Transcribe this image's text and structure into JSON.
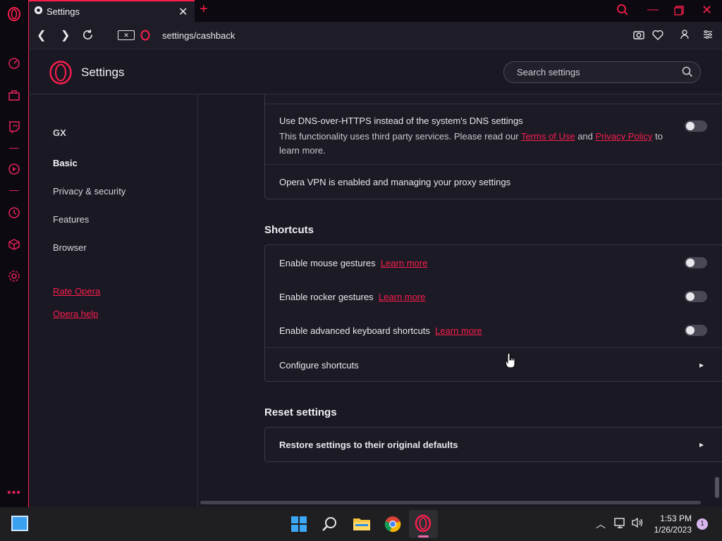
{
  "tab": {
    "title": "Settings"
  },
  "address": {
    "url": "settings/cashback"
  },
  "header": {
    "title": "Settings",
    "search_placeholder": "Search settings"
  },
  "nav": {
    "items": [
      "GX",
      "Basic",
      "Privacy & security",
      "Features",
      "Browser"
    ],
    "links": [
      "Rate Opera",
      "Opera help"
    ]
  },
  "dns": {
    "label": "Use DNS-over-HTTPS instead of the system's DNS settings",
    "desc_before": "This functionality uses third party services. Please read our",
    "terms": "Terms of Use",
    "and": "and",
    "privacy": "Privacy Policy",
    "to": "to",
    "desc_after": "learn more."
  },
  "vpn": {
    "label": "Opera VPN is enabled and managing your proxy settings"
  },
  "shortcuts": {
    "title": "Shortcuts",
    "mouse": "Enable mouse gestures",
    "rocker": "Enable rocker gestures",
    "keyboard": "Enable advanced keyboard shortcuts",
    "learn_more": "Learn more",
    "configure": "Configure shortcuts"
  },
  "reset": {
    "title": "Reset settings",
    "restore": "Restore settings to their original defaults"
  },
  "taskbar": {
    "time": "1:53 PM",
    "date": "1/26/2023",
    "badge": "1"
  },
  "colors": {
    "accent": "#fa1e4e",
    "page_bg": "#1a1823",
    "card_bg": "#1c1a24"
  }
}
